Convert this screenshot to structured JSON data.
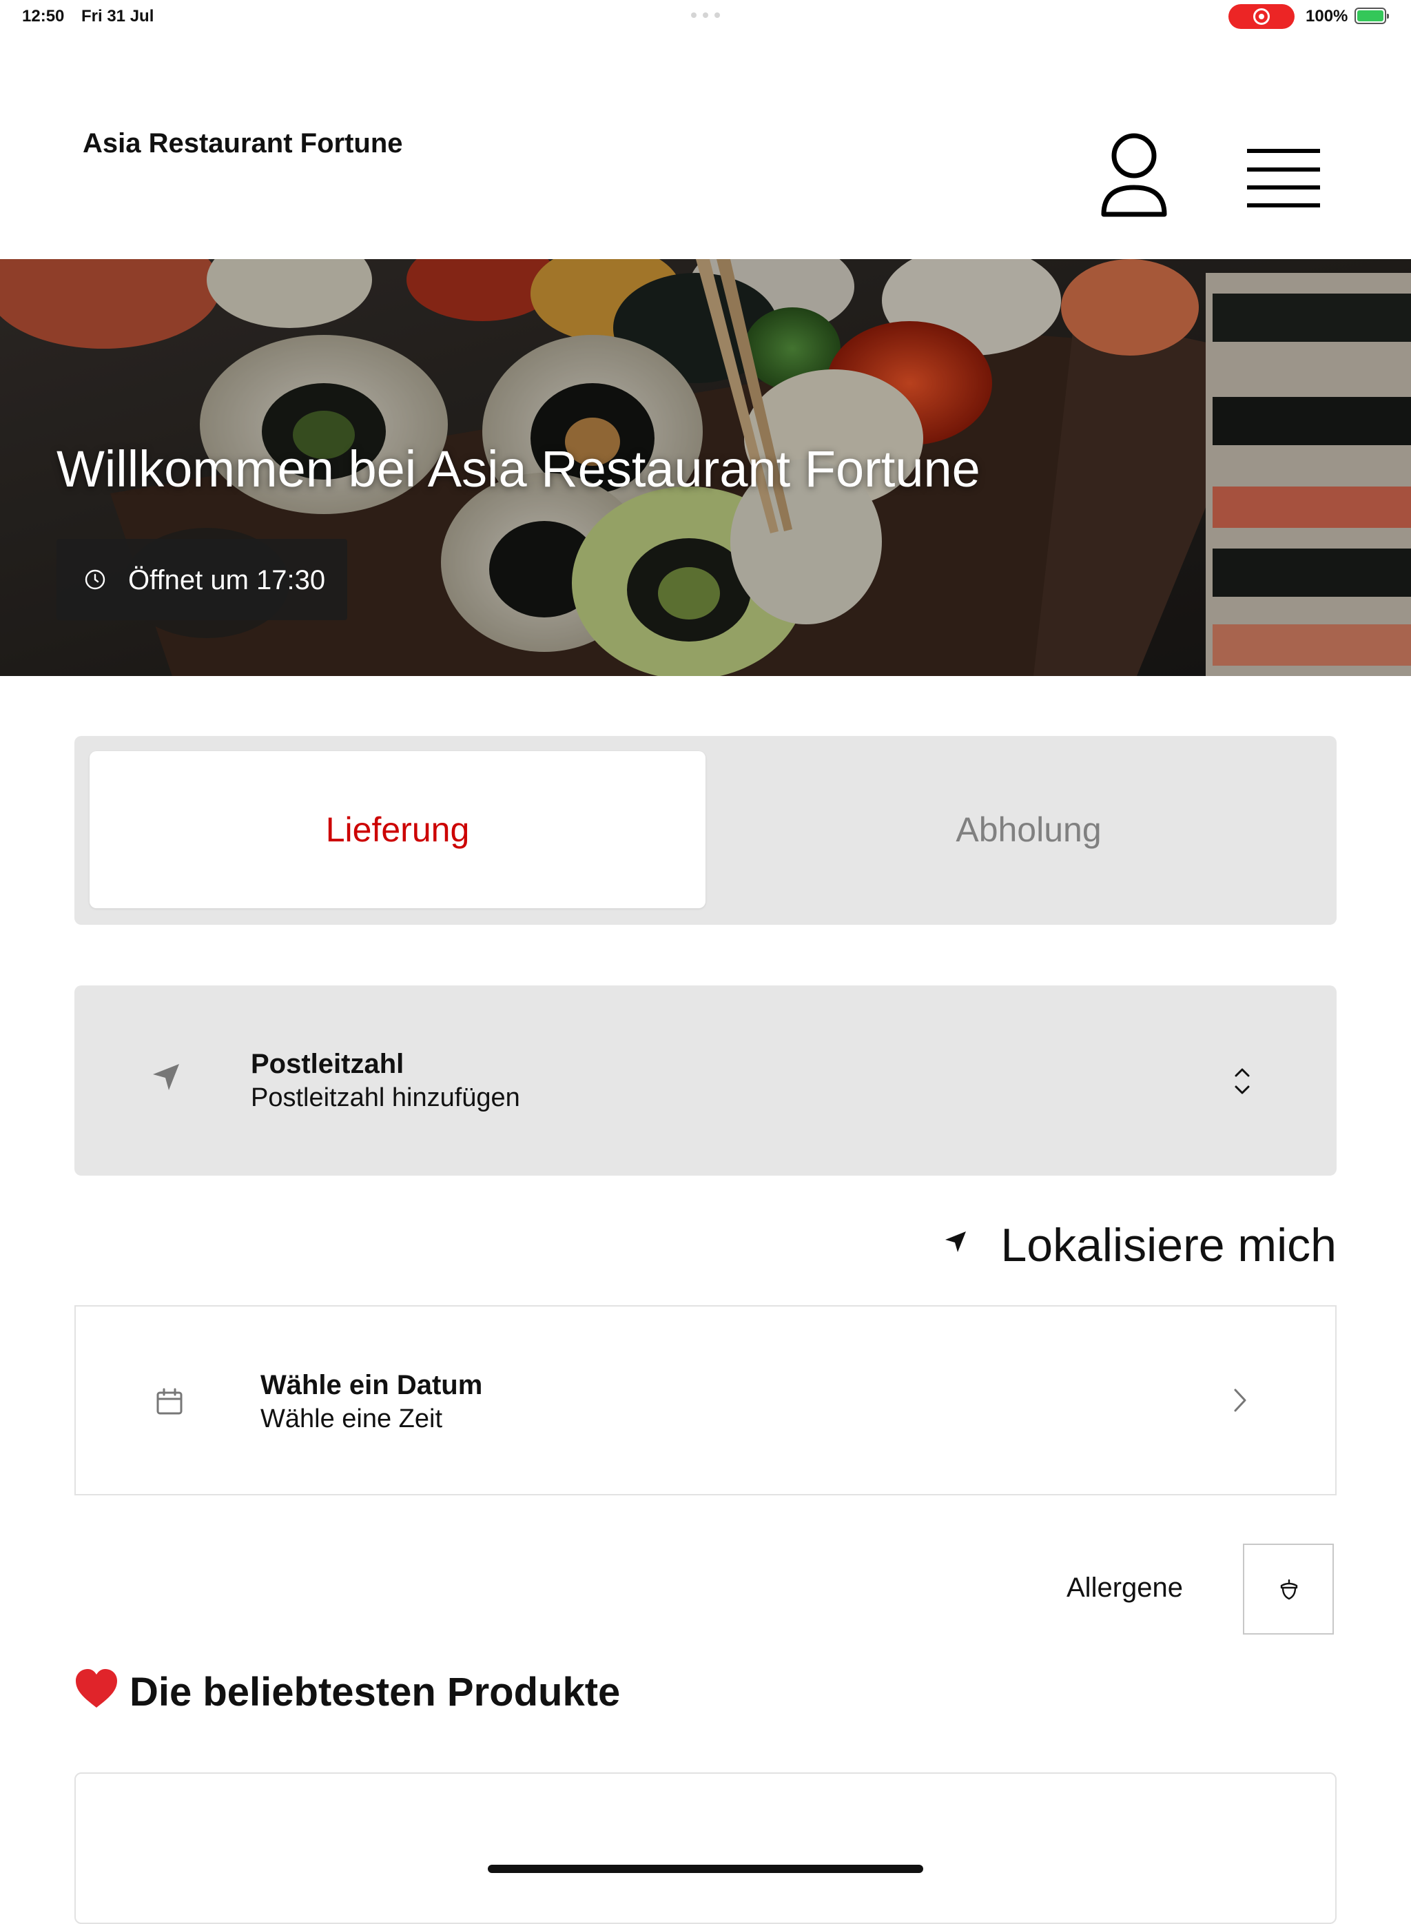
{
  "status_bar": {
    "time": "12:50",
    "date": "Fri 31 Jul",
    "battery_percent": "100%",
    "battery_level": 1.0,
    "recording_color": "#ec2525"
  },
  "header": {
    "brand": "Asia Restaurant Fortune",
    "profile_icon": "user-icon",
    "menu_icon": "hamburger-menu-icon"
  },
  "hero": {
    "title": "Willkommen bei Asia Restaurant Fortune",
    "opening_badge": "Öffnet um 17:30",
    "badge_icon": "clock-icon"
  },
  "order_mode": {
    "options": [
      "Lieferung",
      "Abholung"
    ],
    "selected": "Lieferung",
    "active_color": "#cc0000",
    "inactive_color": "#808080"
  },
  "zip": {
    "label": "Postleitzahl",
    "value": "Postleitzahl hinzufügen",
    "icon": "location-arrow-icon",
    "chevron": "up-down-chevron-icon"
  },
  "locate": {
    "label": "Lokalisiere mich",
    "icon": "location-arrow-icon"
  },
  "schedule": {
    "label": "Wähle ein Datum",
    "value": "Wähle eine Zeit",
    "icon": "calendar-icon",
    "chevron": "chevron-right-icon"
  },
  "allergens": {
    "label": "Allergene",
    "icon": "acorn-icon"
  },
  "popular": {
    "heading": "Die beliebtesten Produkte",
    "icon": "heart-icon",
    "heart_color": "#e0242a"
  }
}
